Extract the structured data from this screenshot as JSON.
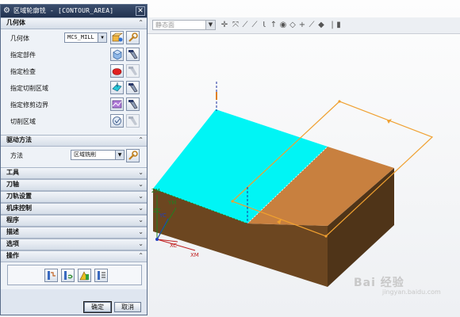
{
  "dialog": {
    "title": "区域轮廓铣 - [CONTOUR_AREA]",
    "close_symbol": "✕",
    "sections": {
      "geometry": {
        "header": "几何体",
        "geometry_label": "几何体",
        "geometry_value": "MCS_MILL",
        "part_label": "指定部件",
        "check_label": "指定检查",
        "cut_area_label": "指定切削区域",
        "trim_label": "指定修剪边界",
        "cut_region_label": "切削区域"
      },
      "drive_method": {
        "header": "驱动方法",
        "method_label": "方法",
        "method_value": "区域铣削"
      },
      "collapsed": [
        {
          "label": "工具"
        },
        {
          "label": "刀轴"
        },
        {
          "label": "刀轨设置"
        },
        {
          "label": "机床控制"
        },
        {
          "label": "程序"
        },
        {
          "label": "描述"
        },
        {
          "label": "选项"
        }
      ],
      "actions": {
        "header": "操作"
      }
    },
    "ok_label": "确定",
    "cancel_label": "取消"
  },
  "toolbar": {
    "view_dropdown_value": "静态面"
  },
  "viewport": {
    "axis_labels": {
      "zm": "ZM",
      "zc": "ZC",
      "ym": "YM",
      "yc": "YC",
      "xc": "XC",
      "xm": "XM"
    }
  },
  "watermark": {
    "text": "Bai 经验",
    "sub": "jingyan.baidu.com"
  },
  "colors": {
    "cut_area": "#00f5f5",
    "block_top": "#c8803f",
    "block_side": "#5e3f1e",
    "block_front": "#7a4e22",
    "trim_boundary": "#f0a030",
    "dialog_title": "#2a3a58"
  }
}
